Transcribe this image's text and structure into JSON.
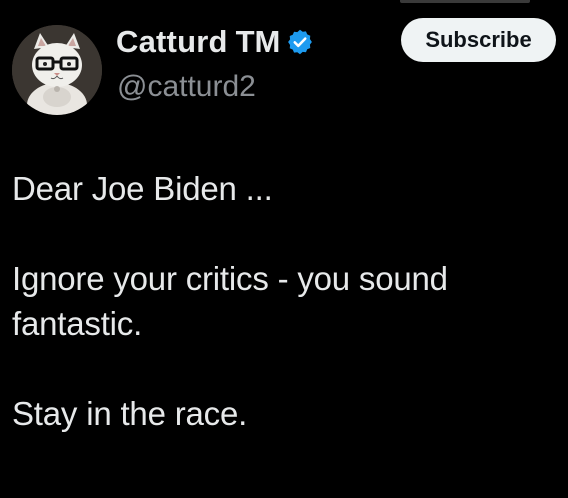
{
  "author": {
    "display_name": "Catturd",
    "name_suffix": "TM",
    "handle": "@catturd2",
    "verified": true,
    "avatar_icon": "cat-with-glasses-avatar"
  },
  "actions": {
    "subscribe_label": "Subscribe"
  },
  "tweet": {
    "lines": [
      "Dear Joe Biden ...",
      "Ignore your critics - you sound",
      "fantastic.",
      "Stay in the race."
    ]
  },
  "colors": {
    "background": "#000000",
    "text": "#e7e9ea",
    "handle": "#8b8f94",
    "verified": "#1d9bf0",
    "button_bg": "#eff3f4",
    "button_text": "#0f1419"
  }
}
